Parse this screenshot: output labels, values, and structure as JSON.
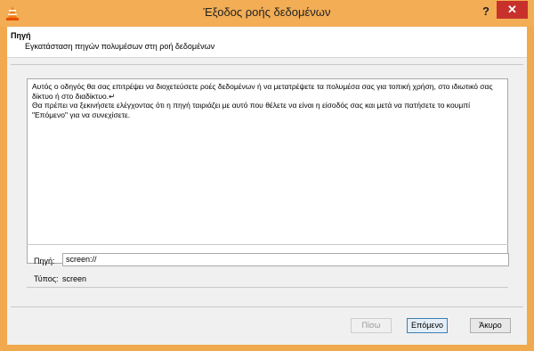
{
  "window": {
    "title": "Έξοδος ροής δεδομένων",
    "help_label": "?",
    "close_label": "✕"
  },
  "header": {
    "title": "Πηγή",
    "subtitle": "Εγκατάσταση πηγών πολυμέσων στη ροή δεδομένων"
  },
  "intro_text": "Αυτός ο οδηγός θα σας επιτρέψει να διοχετεύσετε ροές δεδομένων ή να μετατρέψετε τα πολυμέσα σας για τοπική χρήση, στο ιδιωτικό σας δίκτυο ή στο διαδίκτυο.↵\nΘα πρέπει να ξεκινήσετε ελέγχοντας ότι η πηγή ταιριάζει με αυτό που θέλετε να είναι η είσοδός σας και μετά να πατήσετε το κουμπί \"Επόμενο\" για να συνεχίσετε.",
  "source": {
    "label": "Πηγή:",
    "value": "screen://"
  },
  "type": {
    "label": "Τύπος:",
    "value": "screen"
  },
  "buttons": {
    "back": "Πίσω",
    "next": "Επόμενο",
    "cancel": "Άκυρο"
  },
  "colors": {
    "titlebar": "#f2ad55",
    "close": "#c8312b",
    "client": "#f0f0f0"
  },
  "icons": {
    "app": "vlc-cone-icon",
    "close": "close-icon",
    "help": "help-icon"
  }
}
